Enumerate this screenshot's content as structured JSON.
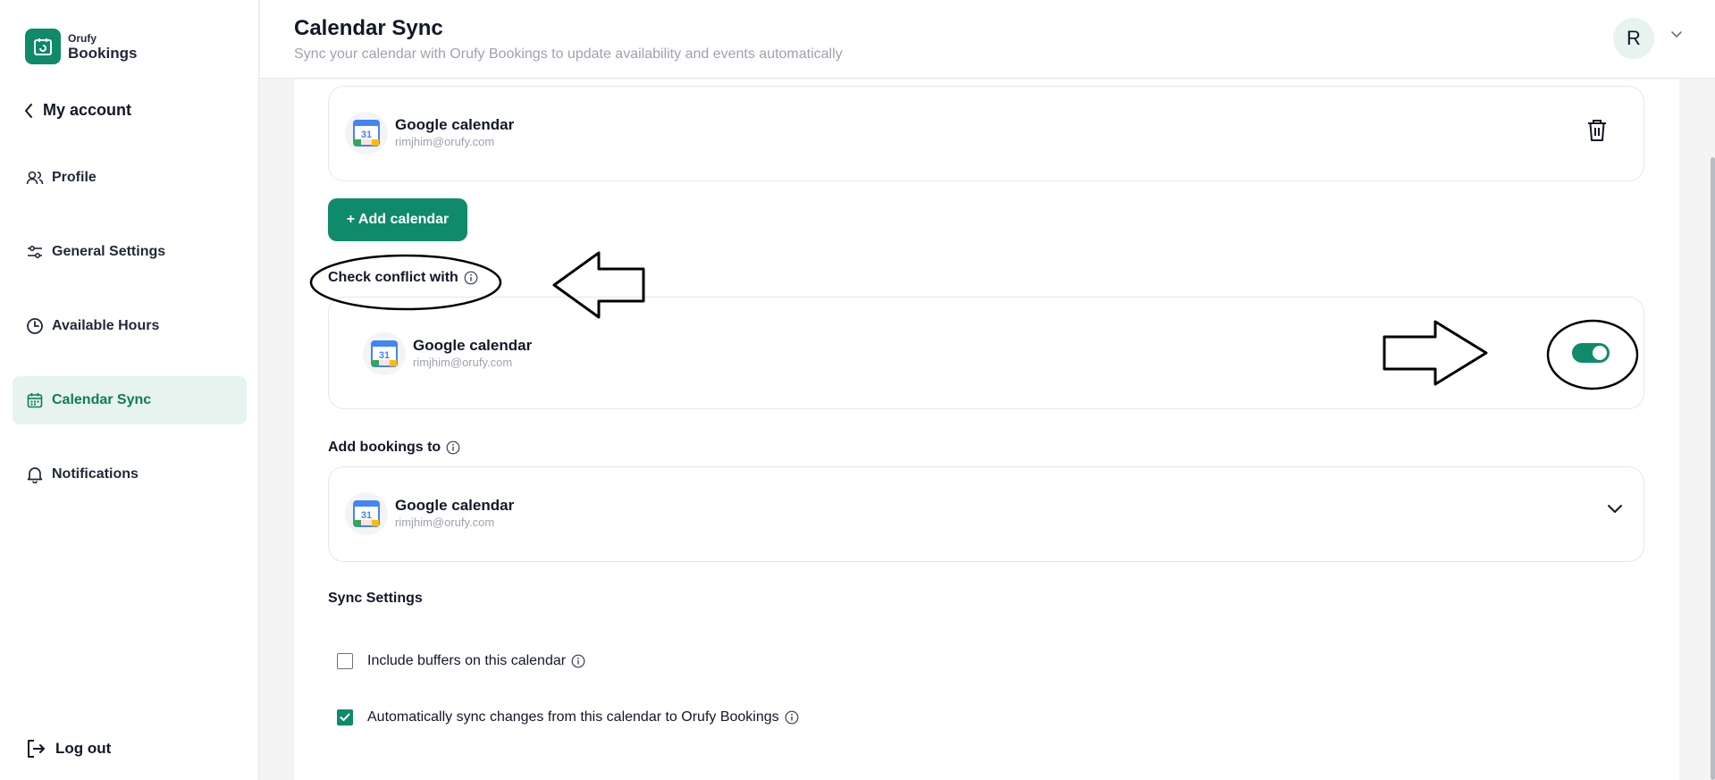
{
  "brand": {
    "small": "Orufy",
    "big": "Bookings",
    "color": "#0f8a6a"
  },
  "sidebar": {
    "back_label": "My account",
    "items": [
      {
        "label": "Profile",
        "icon": "users-icon"
      },
      {
        "label": "General Settings",
        "icon": "sliders-icon"
      },
      {
        "label": "Available Hours",
        "icon": "clock-icon"
      },
      {
        "label": "Calendar Sync",
        "icon": "calendar-icon",
        "active": true
      },
      {
        "label": "Notifications",
        "icon": "bell-icon"
      }
    ],
    "logout_label": "Log out"
  },
  "header": {
    "title": "Calendar Sync",
    "subtitle": "Sync your calendar with Orufy Bookings to update availability and events automatically",
    "avatar_initial": "R"
  },
  "connected_calendar": {
    "name": "Google calendar",
    "email": "rimjhim@orufy.com"
  },
  "add_calendar_label": "+ Add calendar",
  "check_conflict": {
    "label": "Check conflict with",
    "calendar": {
      "name": "Google calendar",
      "email": "rimjhim@orufy.com"
    },
    "enabled": true
  },
  "add_bookings": {
    "label": "Add bookings to",
    "calendar": {
      "name": "Google calendar",
      "email": "rimjhim@orufy.com"
    }
  },
  "sync_settings": {
    "title": "Sync Settings",
    "options": [
      {
        "label": "Include buffers on this calendar",
        "checked": false
      },
      {
        "label": "Automatically sync changes from this calendar to Orufy Bookings",
        "checked": true
      }
    ]
  }
}
